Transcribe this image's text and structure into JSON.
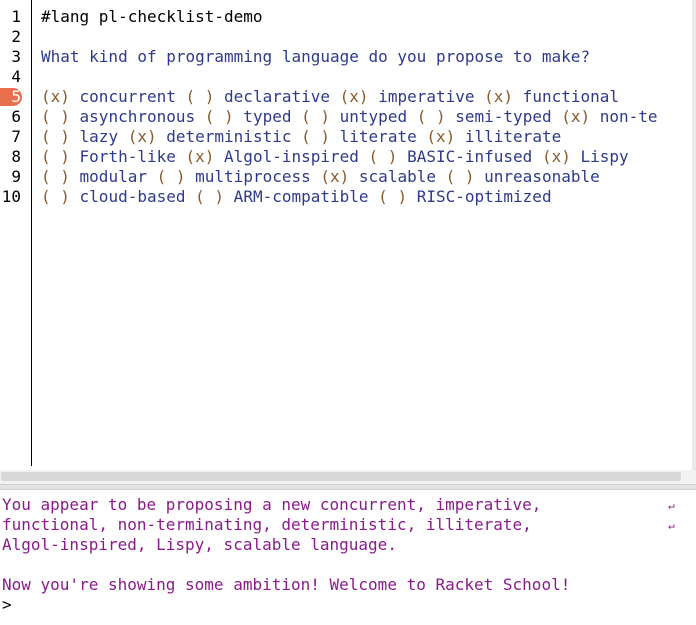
{
  "editor": {
    "current_line": 5,
    "lines": [
      {
        "num": "1",
        "segments": [
          {
            "t": "#lang pl-checklist-demo",
            "k": "plain"
          }
        ]
      },
      {
        "num": "2",
        "segments": []
      },
      {
        "num": "3",
        "segments": [
          {
            "t": "What kind of programming language do you propose to make?",
            "k": "str"
          }
        ]
      },
      {
        "num": "4",
        "segments": []
      },
      {
        "num": "5",
        "segments": [
          {
            "t": "(x)",
            "k": "box"
          },
          {
            "t": " concurrent ",
            "k": "word"
          },
          {
            "t": "( )",
            "k": "box"
          },
          {
            "t": " declarative ",
            "k": "word"
          },
          {
            "t": "(x)",
            "k": "box"
          },
          {
            "t": " imperative ",
            "k": "word"
          },
          {
            "t": "(x)",
            "k": "box"
          },
          {
            "t": " functional",
            "k": "word"
          }
        ]
      },
      {
        "num": "6",
        "segments": [
          {
            "t": "( )",
            "k": "box"
          },
          {
            "t": " asynchronous ",
            "k": "word"
          },
          {
            "t": "( )",
            "k": "box"
          },
          {
            "t": " typed ",
            "k": "word"
          },
          {
            "t": "( )",
            "k": "box"
          },
          {
            "t": " untyped ",
            "k": "word"
          },
          {
            "t": "( )",
            "k": "box"
          },
          {
            "t": " semi-typed ",
            "k": "word"
          },
          {
            "t": "(x)",
            "k": "box"
          },
          {
            "t": " non-te",
            "k": "word"
          }
        ]
      },
      {
        "num": "7",
        "segments": [
          {
            "t": "( )",
            "k": "box"
          },
          {
            "t": " lazy ",
            "k": "word"
          },
          {
            "t": "(x)",
            "k": "box"
          },
          {
            "t": " deterministic ",
            "k": "word"
          },
          {
            "t": "( )",
            "k": "box"
          },
          {
            "t": " literate ",
            "k": "word"
          },
          {
            "t": "(x)",
            "k": "box"
          },
          {
            "t": " illiterate",
            "k": "word"
          }
        ]
      },
      {
        "num": "8",
        "segments": [
          {
            "t": "( )",
            "k": "box"
          },
          {
            "t": " Forth-like ",
            "k": "word"
          },
          {
            "t": "(x)",
            "k": "box"
          },
          {
            "t": " Algol-inspired ",
            "k": "word"
          },
          {
            "t": "( )",
            "k": "box"
          },
          {
            "t": " BASIC-infused ",
            "k": "word"
          },
          {
            "t": "(x)",
            "k": "box"
          },
          {
            "t": " Lispy",
            "k": "word"
          }
        ]
      },
      {
        "num": "9",
        "segments": [
          {
            "t": "( )",
            "k": "box"
          },
          {
            "t": " modular ",
            "k": "word"
          },
          {
            "t": "( )",
            "k": "box"
          },
          {
            "t": " multiprocess ",
            "k": "word"
          },
          {
            "t": "(x)",
            "k": "box"
          },
          {
            "t": " scalable ",
            "k": "word"
          },
          {
            "t": "( )",
            "k": "box"
          },
          {
            "t": " unreasonable",
            "k": "word"
          }
        ]
      },
      {
        "num": "10",
        "segments": [
          {
            "t": "( )",
            "k": "box"
          },
          {
            "t": " cloud-based ",
            "k": "word"
          },
          {
            "t": "( )",
            "k": "box"
          },
          {
            "t": " ARM-compatible ",
            "k": "word"
          },
          {
            "t": "( )",
            "k": "box"
          },
          {
            "t": " RISC-optimized",
            "k": "word"
          }
        ]
      }
    ]
  },
  "repl": {
    "output_lines": [
      "You appear to be proposing a new concurrent, imperative,",
      "functional, non-terminating, deterministic, illiterate,",
      "Algol-inspired, Lispy, scalable language.",
      "",
      "Now you're showing some ambition! Welcome to Racket School!"
    ],
    "wrap_icon": "wrap-continuation-icon",
    "prompt": ">"
  },
  "colors": {
    "current_line_marker": "#e8704f",
    "checkbox": "#8b5a2b",
    "word": "#2e3a8c",
    "repl_output": "#8b1a8b"
  }
}
